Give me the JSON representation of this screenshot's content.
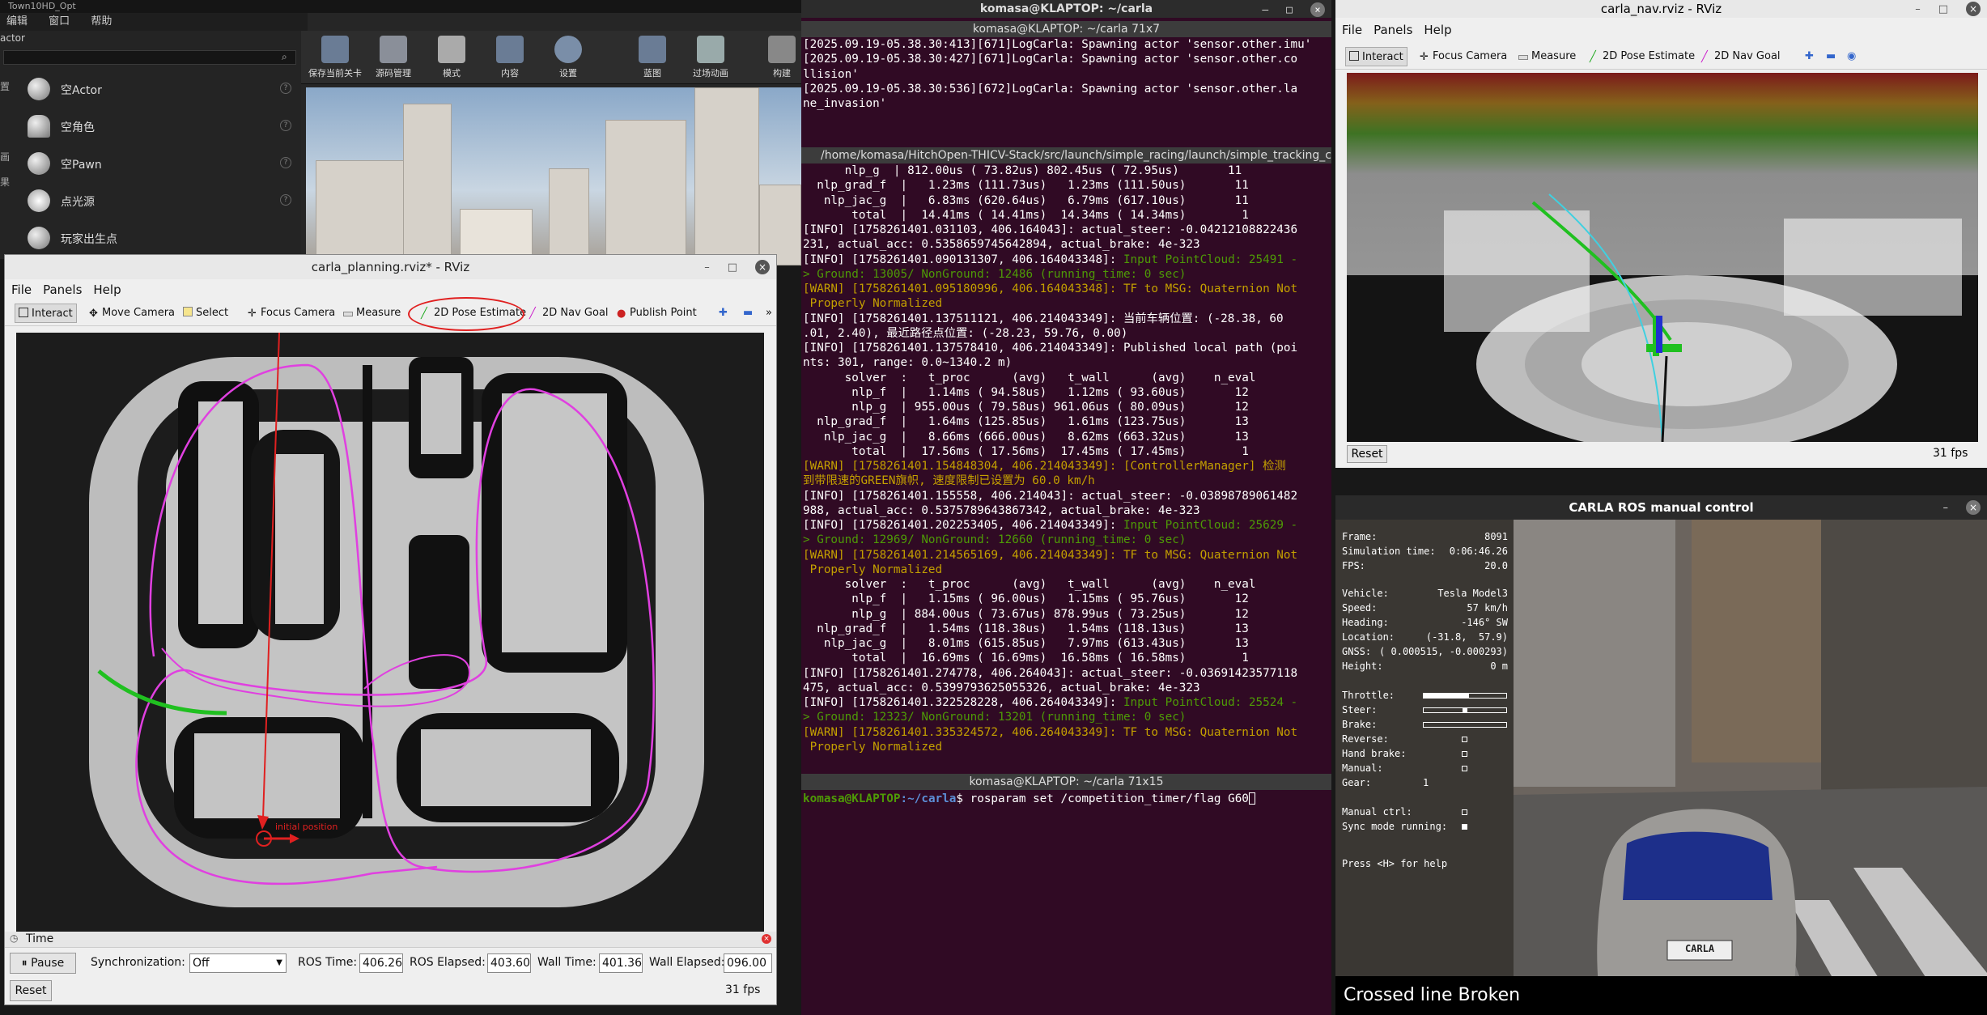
{
  "unreal": {
    "title": "Town10HD_Opt",
    "menu": [
      "编辑",
      "窗口",
      "帮助"
    ],
    "panel_label": "actor",
    "place_items": [
      "空Actor",
      "空角色",
      "空Pawn",
      "点光源",
      "玩家出生点"
    ],
    "side_labels": [
      "置",
      "画",
      "果"
    ],
    "toolbar": [
      "保存当前关卡",
      "源码管理",
      "模式",
      "内容",
      "设置",
      "蓝图",
      "过场动画",
      "构建"
    ]
  },
  "rviz_planning": {
    "title": "carla_planning.rviz* - RViz",
    "menu": [
      "File",
      "Panels",
      "Help"
    ],
    "tools": [
      "Interact",
      "Move Camera",
      "Select",
      "Focus Camera",
      "Measure",
      "2D Pose Estimate",
      "2D Nav Goal",
      "Publish Point"
    ],
    "map_annotation": "initial position",
    "time_panel": {
      "title": "Time",
      "pause_label": "Pause",
      "sync_label": "Synchronization:",
      "sync_value": "Off",
      "ros_time_label": "ROS Time:",
      "ros_time": "406.26",
      "ros_elapsed_label": "ROS Elapsed:",
      "ros_elapsed": "403.60",
      "wall_time_label": "Wall Time:",
      "wall_time": "401.36",
      "wall_elapsed_label": "Wall Elapsed:",
      "wall_elapsed": "096.00",
      "reset_label": "Reset",
      "fps": "31 fps"
    },
    "colors": {
      "route": "#e040e0",
      "annotation": "#e02020",
      "path": "#20c020"
    }
  },
  "terminal": {
    "window_title": "komasa@KLAPTOP: ~/carla",
    "pane1_title": "komasa@KLAPTOP: ~/carla 71x7",
    "pane1_lines": [
      "[2025.09.19-05.38.30:413][671]LogCarla: Spawning actor 'sensor.other.imu'",
      "[2025.09.19-05.38.30:427][671]LogCarla: Spawning actor 'sensor.other.co",
      "llision'",
      "[2025.09.19-05.38.30:536][672]LogCarla: Spawning actor 'sensor.other.la",
      "ne_invasion'"
    ],
    "pane2_title": "/home/komasa/HitchOpen-THICV-Stack/src/launch/simple_racing/launch/simple_tracking_carl",
    "pane2_lines": [
      {
        "t": "      nlp_g  | 812.00us ( 73.82us) 802.45us ( 72.95us)       11",
        "c": ""
      },
      {
        "t": "  nlp_grad_f  |   1.23ms (111.73us)   1.23ms (111.50us)       11",
        "c": ""
      },
      {
        "t": "   nlp_jac_g  |   6.83ms (620.64us)   6.79ms (617.10us)       11",
        "c": ""
      },
      {
        "t": "       total  |  14.41ms ( 14.41ms)  14.34ms ( 14.34ms)        1",
        "c": ""
      },
      {
        "t": "[INFO] [1758261401.031103, 406.164043]: actual_steer: -0.04212108822436",
        "c": ""
      },
      {
        "t": "231, actual_acc: 0.5358659745642894, actual_brake: 4e-323",
        "c": ""
      },
      {
        "t": "[INFO] [1758261401.090131307, 406.164043348]: Input PointCloud: 25491 -",
        "c": "mixg"
      },
      {
        "t": "> Ground: 13005/ NonGround: 12486 (running_time: 0 sec)",
        "c": "green"
      },
      {
        "t": "[WARN] [1758261401.095180996, 406.164043348]: TF to MSG: Quaternion Not",
        "c": "warn"
      },
      {
        "t": " Properly Normalized",
        "c": "warn"
      },
      {
        "t": "[INFO] [1758261401.137511121, 406.214043349]: 当前车辆位置: (-28.38, 60",
        "c": ""
      },
      {
        "t": ".01, 2.40), 最近路径点位置: (-28.23, 59.76, 0.00)",
        "c": ""
      },
      {
        "t": "[INFO] [1758261401.137578410, 406.214043349]: Published local path (poi",
        "c": ""
      },
      {
        "t": "nts: 301, range: 0.0~1340.2 m)",
        "c": ""
      },
      {
        "t": "      solver  :   t_proc      (avg)   t_wall      (avg)    n_eval",
        "c": ""
      },
      {
        "t": "       nlp_f  |   1.14ms ( 94.58us)   1.12ms ( 93.60us)       12",
        "c": ""
      },
      {
        "t": "       nlp_g  | 955.00us ( 79.58us) 961.06us ( 80.09us)       12",
        "c": ""
      },
      {
        "t": "  nlp_grad_f  |   1.64ms (125.85us)   1.61ms (123.75us)       13",
        "c": ""
      },
      {
        "t": "   nlp_jac_g  |   8.66ms (666.00us)   8.62ms (663.32us)       13",
        "c": ""
      },
      {
        "t": "       total  |  17.56ms ( 17.56ms)  17.45ms ( 17.45ms)        1",
        "c": ""
      },
      {
        "t": "[WARN] [1758261401.154848304, 406.214043349]: [ControllerManager] 检测",
        "c": "warn"
      },
      {
        "t": "到带限速的GREEN旗帜, 速度限制已设置为 60.0 km/h",
        "c": "warn"
      },
      {
        "t": "[INFO] [1758261401.155558, 406.214043]: actual_steer: -0.03898789061482",
        "c": ""
      },
      {
        "t": "988, actual_acc: 0.5375789643867342, actual_brake: 4e-323",
        "c": ""
      },
      {
        "t": "[INFO] [1758261401.202253405, 406.214043349]: Input PointCloud: 25629 -",
        "c": "mixg"
      },
      {
        "t": "> Ground: 12969/ NonGround: 12660 (running_time: 0 sec)",
        "c": "green"
      },
      {
        "t": "[WARN] [1758261401.214565169, 406.214043349]: TF to MSG: Quaternion Not",
        "c": "warn"
      },
      {
        "t": " Properly Normalized",
        "c": "warn"
      },
      {
        "t": "      solver  :   t_proc      (avg)   t_wall      (avg)    n_eval",
        "c": ""
      },
      {
        "t": "       nlp_f  |   1.15ms ( 96.00us)   1.15ms ( 95.76us)       12",
        "c": ""
      },
      {
        "t": "       nlp_g  | 884.00us ( 73.67us) 878.99us ( 73.25us)       12",
        "c": ""
      },
      {
        "t": "  nlp_grad_f  |   1.54ms (118.38us)   1.54ms (118.13us)       13",
        "c": ""
      },
      {
        "t": "   nlp_jac_g  |   8.01ms (615.85us)   7.97ms (613.43us)       13",
        "c": ""
      },
      {
        "t": "       total  |  16.69ms ( 16.69ms)  16.58ms ( 16.58ms)        1",
        "c": ""
      },
      {
        "t": "[INFO] [1758261401.274778, 406.264043]: actual_steer: -0.03691423577118",
        "c": ""
      },
      {
        "t": "475, actual_acc: 0.5399793625055326, actual_brake: 4e-323",
        "c": ""
      },
      {
        "t": "[INFO] [1758261401.322528228, 406.264043349]: Input PointCloud: 25524 -",
        "c": "mixg"
      },
      {
        "t": "> Ground: 12323/ NonGround: 13201 (running_time: 0 sec)",
        "c": "green"
      },
      {
        "t": "[WARN] [1758261401.335324572, 406.264043349]: TF to MSG: Quaternion Not",
        "c": "warn"
      },
      {
        "t": " Properly Normalized",
        "c": "warn"
      }
    ],
    "pane3_title": "komasa@KLAPTOP: ~/carla 71x15",
    "prompt_user": "komasa@KLAPTOP",
    "prompt_path": ":~/carla",
    "command": "$ rosparam set /competition_timer/flag G60"
  },
  "rviz_nav": {
    "title": "carla_nav.rviz - RViz",
    "menu": [
      "File",
      "Panels",
      "Help"
    ],
    "tools": [
      "Interact",
      "Focus Camera",
      "Measure",
      "2D Pose Estimate",
      "2D Nav Goal"
    ],
    "reset_label": "Reset",
    "fps": "31 fps"
  },
  "carla_manual": {
    "title": "CARLA ROS manual control",
    "hud": [
      {
        "k": "Frame:",
        "v": "8091"
      },
      {
        "k": "Simulation time:",
        "v": "0:06:46.26"
      },
      {
        "k": "FPS:",
        "v": "20.0"
      },
      {
        "k": "Vehicle:",
        "v": "Tesla Model3"
      },
      {
        "k": "Speed:",
        "v": "57 km/h"
      },
      {
        "k": "Heading:",
        "v": "-146° SW"
      },
      {
        "k": "Location:",
        "v": "(-31.8,  57.9)"
      },
      {
        "k": "GNSS:",
        "v": "( 0.000515, -0.000293)"
      },
      {
        "k": "Height:",
        "v": "0 m"
      }
    ],
    "controls": [
      {
        "k": "Throttle:",
        "type": "bar",
        "level": 0.55
      },
      {
        "k": "Steer:",
        "type": "bar",
        "level": 0.5
      },
      {
        "k": "Brake:",
        "type": "bar",
        "level": 0.0
      },
      {
        "k": "Reverse:",
        "type": "check",
        "on": false
      },
      {
        "k": "Hand brake:",
        "type": "check",
        "on": false
      },
      {
        "k": "Manual:",
        "type": "check",
        "on": false
      },
      {
        "k": "Gear:",
        "type": "text",
        "v": "1"
      }
    ],
    "manual_ctrl": "Manual ctrl:",
    "sync_mode": "Sync mode running:",
    "help": "Press <H> for help",
    "plate": "CARLA",
    "notification": "Crossed line Broken"
  }
}
